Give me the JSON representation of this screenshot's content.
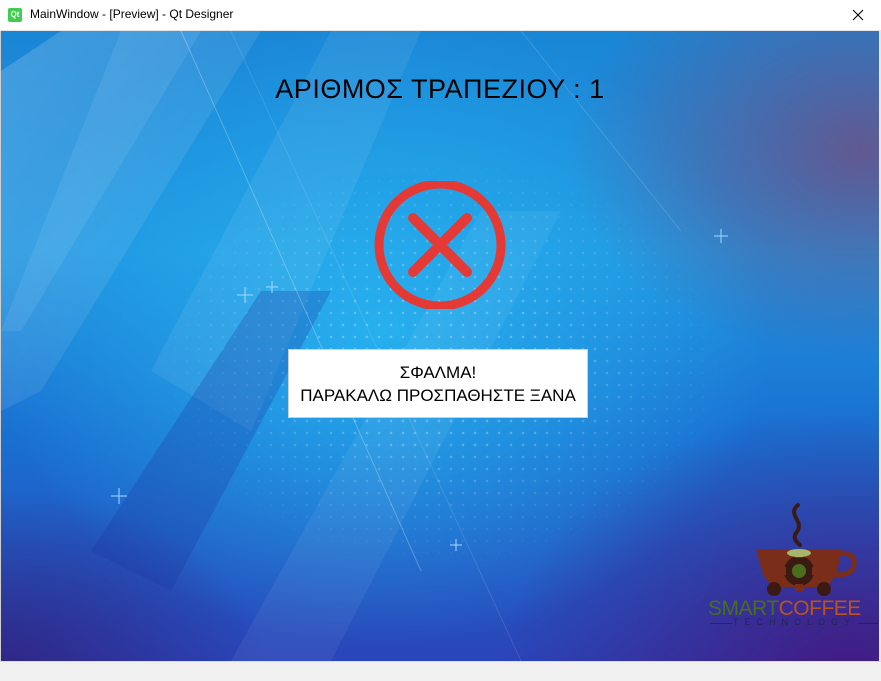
{
  "window": {
    "title": "MainWindow - [Preview] - Qt Designer",
    "app_icon_text": "Qt",
    "app_icon_color": "#41cd52"
  },
  "main": {
    "heading": "ΑΡΙΘΜΟΣ ΤΡΑΠΕΖΙΟΥ : 1",
    "status_icon": "error-x-circle-icon",
    "status_icon_color": "#e53935",
    "message_line1": "ΣΦΑΛΜΑ!",
    "message_line2": "ΠΑΡΑΚΑΛΩ ΠΡΟΣΠΑΘΗΣΤΕ ΞΑΝΑ"
  },
  "logo": {
    "word_smart": "SMART",
    "word_coffee": "COFFEE",
    "tagline": "TECHNOLOGY",
    "smart_color": "#4a6d1e",
    "coffee_color": "#b8541d"
  }
}
